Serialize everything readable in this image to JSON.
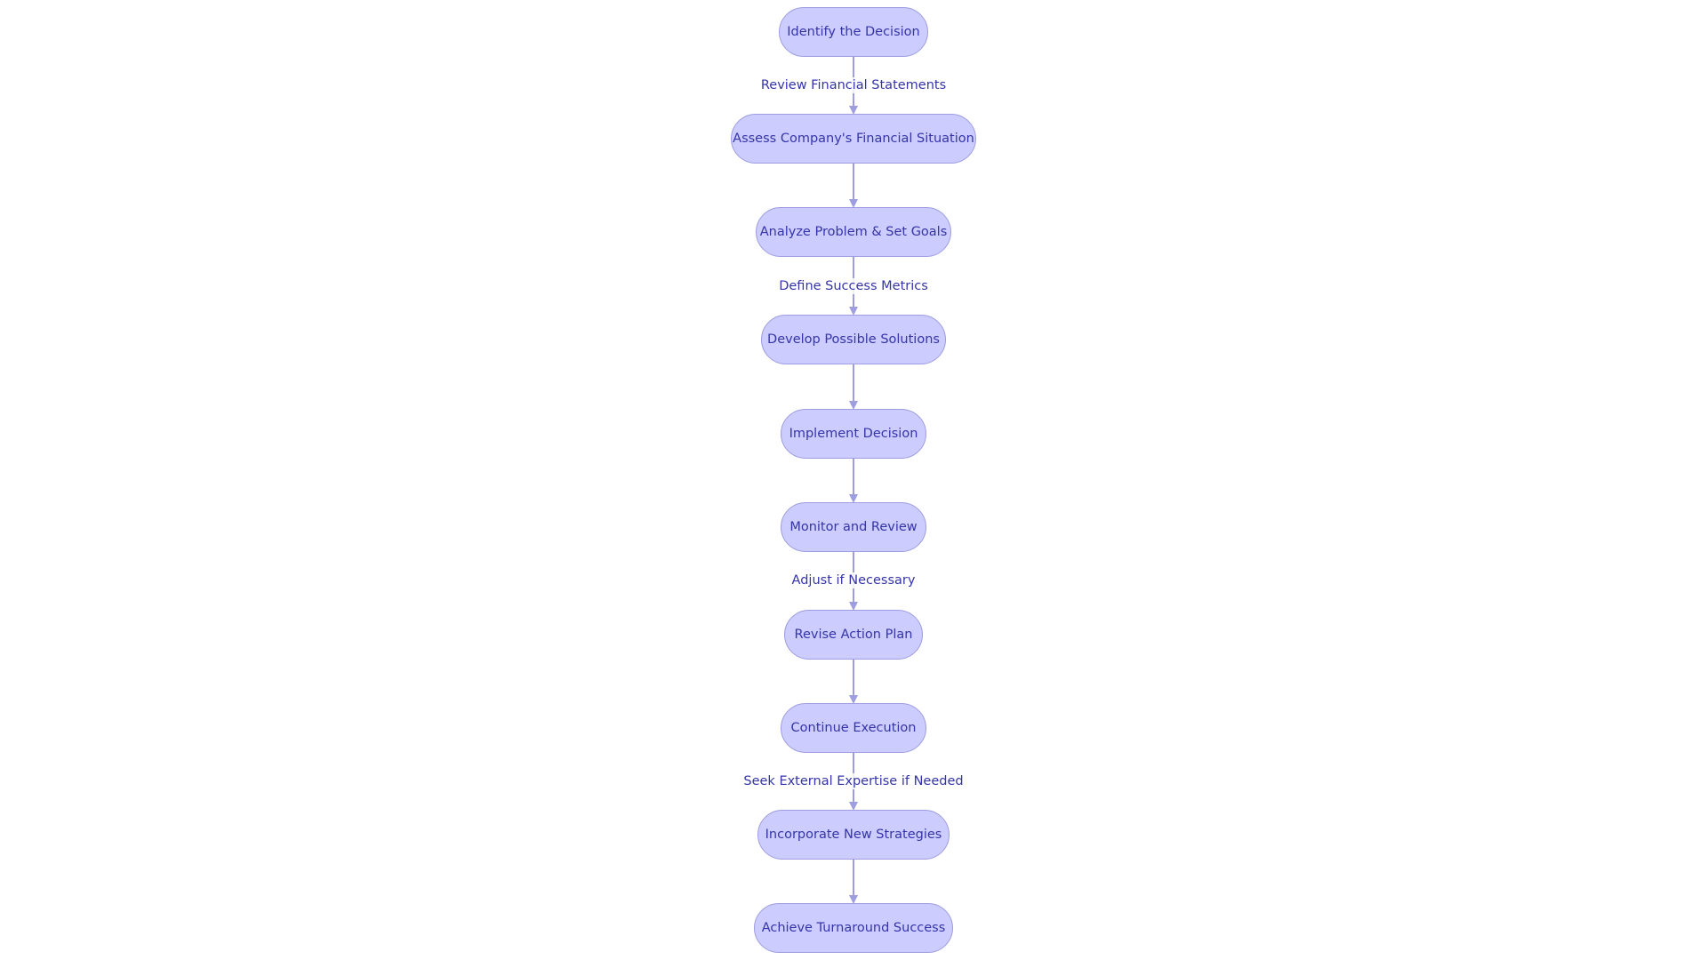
{
  "diagram": {
    "type": "flowchart",
    "direction": "top-to-bottom",
    "colors": {
      "node_fill": "#ccccff",
      "node_border": "#9d9de0",
      "text": "#3535a8",
      "edge": "#9d9de0"
    },
    "nodes": [
      {
        "id": "n1",
        "label": "Identify the Decision"
      },
      {
        "id": "n2",
        "label": "Assess Company's Financial Situation"
      },
      {
        "id": "n3",
        "label": "Analyze Problem & Set Goals"
      },
      {
        "id": "n4",
        "label": "Develop Possible Solutions"
      },
      {
        "id": "n5",
        "label": "Implement Decision"
      },
      {
        "id": "n6",
        "label": "Monitor and Review"
      },
      {
        "id": "n7",
        "label": "Revise Action Plan"
      },
      {
        "id": "n8",
        "label": "Continue Execution"
      },
      {
        "id": "n9",
        "label": "Incorporate New Strategies"
      },
      {
        "id": "n10",
        "label": "Achieve Turnaround Success"
      }
    ],
    "edges": [
      {
        "from": "n1",
        "to": "n2",
        "label": "Review Financial Statements"
      },
      {
        "from": "n2",
        "to": "n3",
        "label": ""
      },
      {
        "from": "n3",
        "to": "n4",
        "label": "Define Success Metrics"
      },
      {
        "from": "n4",
        "to": "n5",
        "label": ""
      },
      {
        "from": "n5",
        "to": "n6",
        "label": ""
      },
      {
        "from": "n6",
        "to": "n7",
        "label": "Adjust if Necessary"
      },
      {
        "from": "n7",
        "to": "n8",
        "label": ""
      },
      {
        "from": "n8",
        "to": "n9",
        "label": "Seek External Expertise if Needed"
      },
      {
        "from": "n9",
        "to": "n10",
        "label": ""
      }
    ]
  }
}
